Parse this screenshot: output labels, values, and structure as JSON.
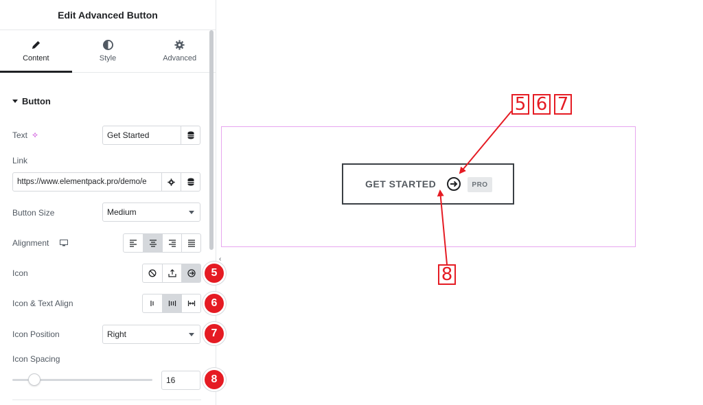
{
  "panel": {
    "title": "Edit Advanced Button",
    "tabs": [
      {
        "label": "Content",
        "icon": "pencil-icon"
      },
      {
        "label": "Style",
        "icon": "contrast-icon"
      },
      {
        "label": "Advanced",
        "icon": "gear-icon"
      }
    ],
    "section_title": "Button",
    "fields": {
      "text_label": "Text",
      "text_value": "Get Started",
      "link_label": "Link",
      "link_value": "https://www.elementpack.pro/demo/e",
      "size_label": "Button Size",
      "size_value": "Medium",
      "alignment_label": "Alignment",
      "icon_label": "Icon",
      "icon_text_align_label": "Icon & Text Align",
      "icon_position_label": "Icon Position",
      "icon_position_value": "Right",
      "icon_spacing_label": "Icon Spacing",
      "icon_spacing_value": "16",
      "icon_spacing_slider_fraction": 0.16
    },
    "badges": [
      "5",
      "6",
      "7",
      "8"
    ]
  },
  "preview": {
    "button_label": "GET STARTED",
    "button_icon": "arrow-right-circle-icon",
    "pro_tag": "PRO"
  },
  "annotations": {
    "top_numbers": [
      "5",
      "6",
      "7"
    ],
    "bottom_number": "8",
    "color": "#e51b23"
  },
  "colors": {
    "accent_badge": "#e51b23",
    "preview_outline": "#e7a5ef"
  }
}
